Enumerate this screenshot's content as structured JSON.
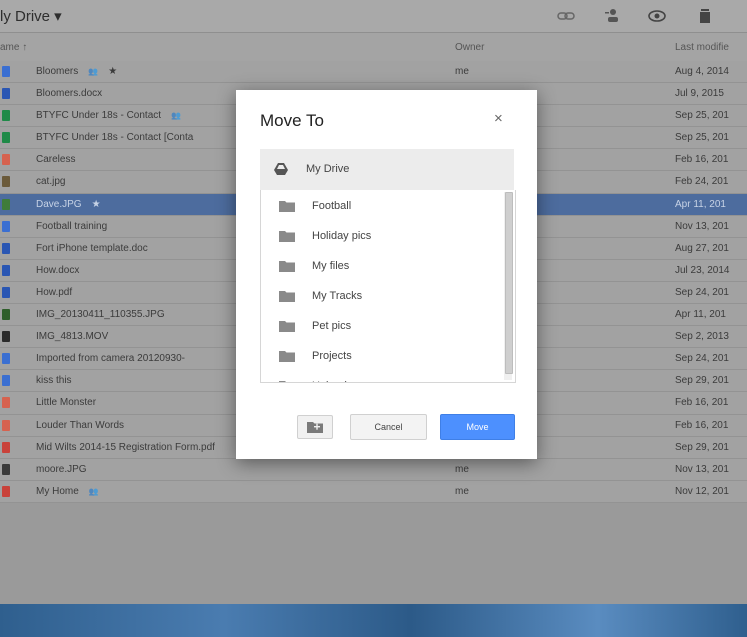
{
  "header": {
    "title": "ly Drive ▾",
    "icons": [
      "link-icon",
      "add-person-icon",
      "preview-eye-icon",
      "trash-icon"
    ]
  },
  "columns": {
    "name": "ame ↑",
    "owner": "Owner",
    "modified": "Last modifie"
  },
  "files": [
    {
      "name": "Bloomers",
      "shared": true,
      "starred": true,
      "owner": "me",
      "date": "Aug 4, 2014",
      "type": "doc",
      "color": "#3b6fd1"
    },
    {
      "name": "Bloomers.docx",
      "shared": false,
      "starred": false,
      "owner": "",
      "date": "Jul 9, 2015",
      "type": "word",
      "color": "#2a56b3"
    },
    {
      "name": "BTYFC Under 18s - Contact",
      "shared": true,
      "starred": false,
      "owner": "",
      "date": "Sep 25, 201",
      "type": "sheet",
      "color": "#1f8a48"
    },
    {
      "name": "BTYFC Under 18s - Contact [Conta",
      "shared": false,
      "starred": false,
      "owner": "",
      "date": "Sep 25, 201",
      "type": "sheet",
      "color": "#1f8a48"
    },
    {
      "name": "Careless",
      "shared": false,
      "starred": false,
      "owner": "",
      "date": "Feb 16, 201",
      "type": "audio",
      "color": "#d6624f"
    },
    {
      "name": "cat.jpg",
      "shared": false,
      "starred": false,
      "owner": "",
      "date": "Feb 24, 201",
      "type": "image",
      "color": "#6b5a3a"
    },
    {
      "name": "Dave.JPG",
      "shared": false,
      "starred": true,
      "owner": "",
      "date": "Apr 11, 201",
      "type": "image",
      "color": "#3f7c3a",
      "selected": true
    },
    {
      "name": "Football training",
      "shared": false,
      "starred": false,
      "owner": "",
      "date": "Nov 13, 201",
      "type": "doc",
      "color": "#3b6fd1"
    },
    {
      "name": "Fort iPhone template.doc",
      "shared": false,
      "starred": false,
      "owner": "",
      "date": "Aug 27, 201",
      "type": "word",
      "color": "#2a56b3"
    },
    {
      "name": "How.docx",
      "shared": false,
      "starred": false,
      "owner": "",
      "date": "Jul 23, 2014",
      "type": "word",
      "color": "#2a56b3"
    },
    {
      "name": "How.pdf",
      "shared": false,
      "starred": false,
      "owner": "",
      "date": "Sep 24, 201",
      "type": "pdf",
      "color": "#2a56b3"
    },
    {
      "name": "IMG_20130411_110355.JPG",
      "shared": false,
      "starred": false,
      "owner": "",
      "date": "Apr 11, 201",
      "type": "image",
      "color": "#2f5e2a"
    },
    {
      "name": "IMG_4813.MOV",
      "shared": false,
      "starred": false,
      "owner": "",
      "date": "Sep 2, 2013",
      "type": "video",
      "color": "#2b2b2b"
    },
    {
      "name": "Imported from camera 20120930-",
      "shared": false,
      "starred": false,
      "owner": "",
      "date": "Sep 24, 201",
      "type": "doc",
      "color": "#3b6fd1"
    },
    {
      "name": "kiss this",
      "shared": false,
      "starred": false,
      "owner": "",
      "date": "Sep 29, 201",
      "type": "doc",
      "color": "#3b6fd1"
    },
    {
      "name": "Little Monster",
      "shared": false,
      "starred": false,
      "owner": "me",
      "date": "Feb 16, 201",
      "type": "audio",
      "color": "#d6624f"
    },
    {
      "name": "Louder Than Words",
      "shared": false,
      "starred": false,
      "owner": "me",
      "date": "Feb 16, 201",
      "type": "audio",
      "color": "#d6624f"
    },
    {
      "name": "Mid Wilts 2014-15 Registration Form.pdf",
      "shared": false,
      "starred": false,
      "owner": "me",
      "date": "Sep 29, 201",
      "type": "pdf",
      "color": "#c9423a"
    },
    {
      "name": "moore.JPG",
      "shared": false,
      "starred": false,
      "owner": "me",
      "date": "Nov 13, 201",
      "type": "image",
      "color": "#3a3a3a"
    },
    {
      "name": "My Home",
      "shared": true,
      "starred": false,
      "owner": "me",
      "date": "Nov 12, 201",
      "type": "slides",
      "color": "#c9423a"
    }
  ],
  "dialog": {
    "title": "Move To",
    "close": "×",
    "root": "My Drive",
    "folders": [
      "Football",
      "Holiday pics",
      "My files",
      "My Tracks",
      "Pet pics",
      "Projects",
      "Uploads"
    ],
    "cancel": "Cancel",
    "move": "Move"
  },
  "colors": {
    "move_button": "#4d90fe",
    "selection": "#4d6c9e",
    "folder": "#8a8a8a"
  }
}
